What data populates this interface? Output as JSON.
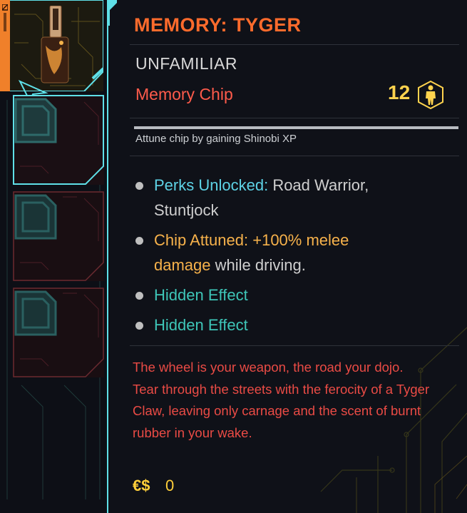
{
  "tooltip": {
    "title": "MEMORY: TYGER",
    "rarity": "UNFAMILIAR",
    "item_type": "Memory Chip",
    "level": "12",
    "level_icon": "humanoid-hex-icon",
    "attune_hint": "Attune chip by gaining Shinobi XP",
    "attune_progress": 1.0,
    "perks_label": "Perks Unlocked:",
    "perks_value_line1": "Road Warrior,",
    "perks_value_line2": "Stuntjock",
    "attuned_label": "Chip Attuned:",
    "attuned_value1": "+100% melee",
    "attuned_value2": "damage",
    "attuned_value3": "while driving.",
    "hidden_effect_1": "Hidden Effect",
    "hidden_effect_2": "Hidden Effect",
    "lore": "The wheel is your weapon, the road your dojo. Tear through the streets with the ferocity of a Tyger Claw, leaving only carnage and the scent of burnt rubber in your wake.",
    "currency_symbol": "€$",
    "price": "0"
  },
  "slots": [
    {
      "state": "equipped",
      "icon": "memory-chip-item-icon"
    },
    {
      "state": "selected-empty",
      "icon": "chip-slot-icon"
    },
    {
      "state": "empty",
      "icon": "chip-slot-icon"
    },
    {
      "state": "empty",
      "icon": "chip-slot-icon"
    }
  ],
  "colors": {
    "title": "#ff6b2c",
    "item_type": "#ff5b4b",
    "level": "#ffd34e",
    "perk_label": "#5ed3e6",
    "attuned": "#f7b24b",
    "hidden": "#3ec6b8",
    "lore": "#ea4b45",
    "frame_cyan": "#5fe0e8",
    "slot_red": "#7a2a32"
  }
}
